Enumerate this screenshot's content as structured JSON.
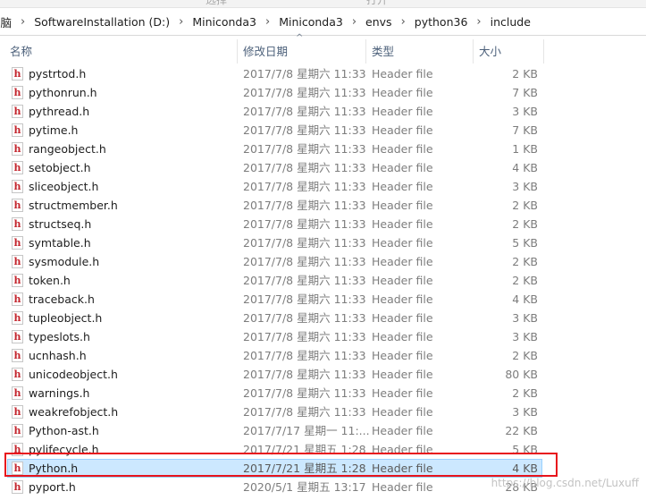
{
  "address": {
    "crumbs": [
      "电脑",
      "SoftwareInstallation (D:)",
      "Miniconda3",
      "Miniconda3",
      "envs",
      "python36",
      "include"
    ]
  },
  "columns": {
    "name": "名称",
    "date": "修改日期",
    "type": "类型",
    "size": "大小",
    "sort_indicator": "^"
  },
  "icon_glyph": "h",
  "files": [
    {
      "name": "pystrtod.h",
      "date": "2017/7/8 星期六 11:33",
      "type": "Header file",
      "size": "2 KB"
    },
    {
      "name": "pythonrun.h",
      "date": "2017/7/8 星期六 11:33",
      "type": "Header file",
      "size": "7 KB"
    },
    {
      "name": "pythread.h",
      "date": "2017/7/8 星期六 11:33",
      "type": "Header file",
      "size": "3 KB"
    },
    {
      "name": "pytime.h",
      "date": "2017/7/8 星期六 11:33",
      "type": "Header file",
      "size": "7 KB"
    },
    {
      "name": "rangeobject.h",
      "date": "2017/7/8 星期六 11:33",
      "type": "Header file",
      "size": "1 KB"
    },
    {
      "name": "setobject.h",
      "date": "2017/7/8 星期六 11:33",
      "type": "Header file",
      "size": "4 KB"
    },
    {
      "name": "sliceobject.h",
      "date": "2017/7/8 星期六 11:33",
      "type": "Header file",
      "size": "3 KB"
    },
    {
      "name": "structmember.h",
      "date": "2017/7/8 星期六 11:33",
      "type": "Header file",
      "size": "2 KB"
    },
    {
      "name": "structseq.h",
      "date": "2017/7/8 星期六 11:33",
      "type": "Header file",
      "size": "2 KB"
    },
    {
      "name": "symtable.h",
      "date": "2017/7/8 星期六 11:33",
      "type": "Header file",
      "size": "5 KB"
    },
    {
      "name": "sysmodule.h",
      "date": "2017/7/8 星期六 11:33",
      "type": "Header file",
      "size": "2 KB"
    },
    {
      "name": "token.h",
      "date": "2017/7/8 星期六 11:33",
      "type": "Header file",
      "size": "2 KB"
    },
    {
      "name": "traceback.h",
      "date": "2017/7/8 星期六 11:33",
      "type": "Header file",
      "size": "4 KB"
    },
    {
      "name": "tupleobject.h",
      "date": "2017/7/8 星期六 11:33",
      "type": "Header file",
      "size": "3 KB"
    },
    {
      "name": "typeslots.h",
      "date": "2017/7/8 星期六 11:33",
      "type": "Header file",
      "size": "3 KB"
    },
    {
      "name": "ucnhash.h",
      "date": "2017/7/8 星期六 11:33",
      "type": "Header file",
      "size": "2 KB"
    },
    {
      "name": "unicodeobject.h",
      "date": "2017/7/8 星期六 11:33",
      "type": "Header file",
      "size": "80 KB"
    },
    {
      "name": "warnings.h",
      "date": "2017/7/8 星期六 11:33",
      "type": "Header file",
      "size": "2 KB"
    },
    {
      "name": "weakrefobject.h",
      "date": "2017/7/8 星期六 11:33",
      "type": "Header file",
      "size": "3 KB"
    },
    {
      "name": "Python-ast.h",
      "date": "2017/7/17 星期一 11:...",
      "type": "Header file",
      "size": "22 KB"
    },
    {
      "name": "pylifecycle.h",
      "date": "2017/7/21 星期五 1:28",
      "type": "Header file",
      "size": "5 KB"
    },
    {
      "name": "Python.h",
      "date": "2017/7/21 星期五 1:28",
      "type": "Header file",
      "size": "4 KB",
      "selected": true
    },
    {
      "name": "pyport.h",
      "date": "2020/5/1 星期五 13:17",
      "type": "Header file",
      "size": "28 KB"
    }
  ],
  "watermark": "https://blog.csdn.net/Luxuff"
}
